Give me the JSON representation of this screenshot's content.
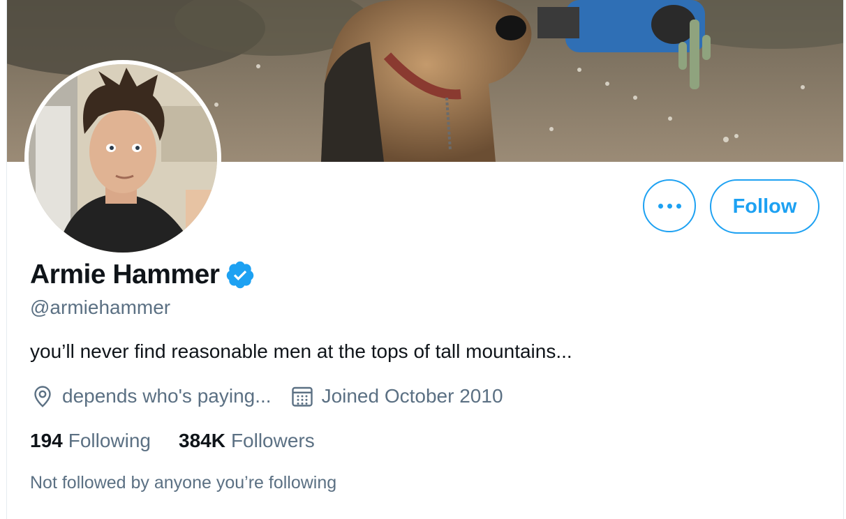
{
  "profile": {
    "name": "Armie Hammer",
    "handle": "@armiehammer",
    "bio": "you’ll never find reasonable men at the tops of tall mountains...",
    "location": "depends who's paying...",
    "joined": "Joined October 2010",
    "verified": true
  },
  "stats": {
    "following_count": "194",
    "following_label": "Following",
    "followers_count": "384K",
    "followers_label": "Followers"
  },
  "social_context": "Not followed by anyone you’re following",
  "actions": {
    "follow_label": "Follow",
    "more_icon": "more-horizontal-icon"
  },
  "icons": {
    "location": "location-pin-icon",
    "calendar": "calendar-icon",
    "verified": "verified-badge-icon"
  },
  "colors": {
    "accent": "#1da1f2",
    "text_primary": "#0f1419",
    "text_secondary": "#5b7083"
  }
}
